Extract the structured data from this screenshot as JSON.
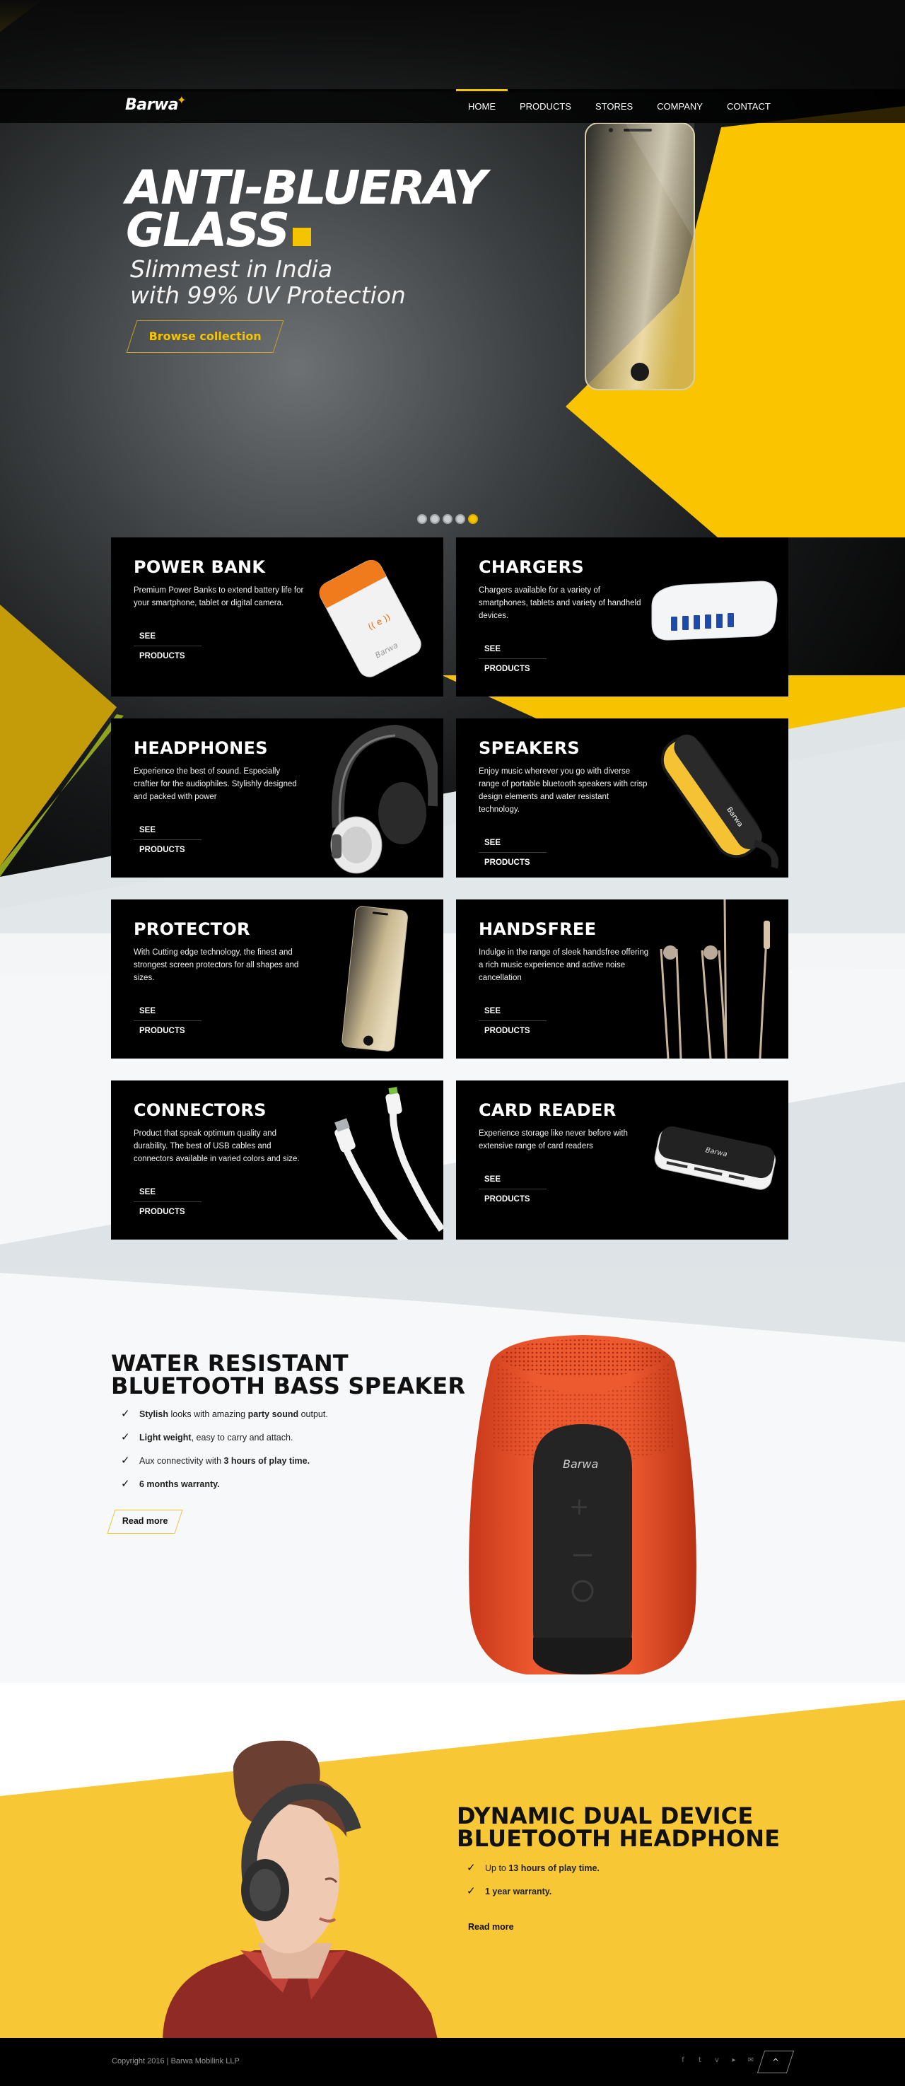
{
  "nav": {
    "logo": "Barwa",
    "items": [
      {
        "label": "HOME",
        "active": true
      },
      {
        "label": "PRODUCTS"
      },
      {
        "label": "STORES"
      },
      {
        "label": "COMPANY"
      },
      {
        "label": "CONTACT"
      }
    ]
  },
  "hero": {
    "title_line1": "ANTI-BLUERAY",
    "title_line2": "GLASS",
    "subtitle_line1": "Slimmest in India",
    "subtitle_line2": "with 99% UV Protection",
    "button": "Browse collection",
    "slides_count": 5,
    "active_slide": 5
  },
  "products": [
    {
      "title": "POWER BANK",
      "desc": "Premium Power Banks to extend battery life for your smartphone, tablet or digital camera.",
      "button": "SEE PRODUCTS"
    },
    {
      "title": "CHARGERS",
      "desc": "Chargers available for a variety of smartphones, tablets and variety of handheld devices.",
      "button": "SEE PRODUCTS"
    },
    {
      "title": "HEADPHONES",
      "desc": "Experience the best of sound. Especially craftier for the audiophiles. Stylishly designed and packed with power",
      "button": "SEE PRODUCTS"
    },
    {
      "title": "SPEAKERS",
      "desc": "Enjoy music wherever you go with diverse range of portable bluetooth speakers with crisp design elements and water resistant technology.",
      "button": "SEE PRODUCTS"
    },
    {
      "title": "PROTECTOR",
      "desc": "With Cutting edge technology, the finest and strongest screen protectors for all shapes and sizes.",
      "button": "SEE PRODUCTS"
    },
    {
      "title": "HANDSFREE",
      "desc": "Indulge in the range of sleek handsfree offering a rich music experience and active noise cancellation",
      "button": "SEE PRODUCTS"
    },
    {
      "title": "CONNECTORS",
      "desc": "Product that speak optimum quality and durability. The best of USB cables and connectors available in varied colors and size.",
      "button": "SEE PRODUCTS"
    },
    {
      "title": "CARD READER",
      "desc": "Experience storage like never before with extensive range of card readers",
      "button": "SEE PRODUCTS"
    }
  ],
  "speaker_feature": {
    "title_line1": "WATER RESISTANT",
    "title_line2": "BLUETOOTH BASS SPEAKER",
    "points": [
      {
        "bold1": "Stylish",
        "text1": " looks with amazing ",
        "bold2": "party sound",
        "text2": " output."
      },
      {
        "bold1": "Light weight",
        "text1": ", easy to carry and attach.",
        "bold2": "",
        "text2": ""
      },
      {
        "bold1": "",
        "text1": "Aux connectivity with ",
        "bold2": "3 hours of play time.",
        "text2": ""
      },
      {
        "bold1": "6 months warranty.",
        "text1": "",
        "bold2": "",
        "text2": ""
      }
    ],
    "button": "Read more",
    "product_logo": "Barwa"
  },
  "headphone_feature": {
    "title_line1": "DYNAMIC DUAL DEVICE",
    "title_line2": "BLUETOOTH HEADPHONE",
    "points": [
      {
        "text1": "Up to ",
        "bold": "13 hours of play time."
      },
      {
        "text1": "",
        "bold": "1 year warranty."
      }
    ],
    "button": "Read more"
  },
  "footer": {
    "copyright": "Copyright 2016 | Barwa Mobilink LLP",
    "socials": [
      "facebook-icon",
      "twitter-icon",
      "vimeo-icon",
      "youtube-icon",
      "email-icon"
    ],
    "social_glyphs": [
      "f",
      "t",
      "v",
      "▸",
      "✉"
    ],
    "totop_glyph": "^"
  },
  "colors": {
    "accent": "#f5c400",
    "dark": "#000000",
    "light_bg": "#e4e8ea"
  }
}
